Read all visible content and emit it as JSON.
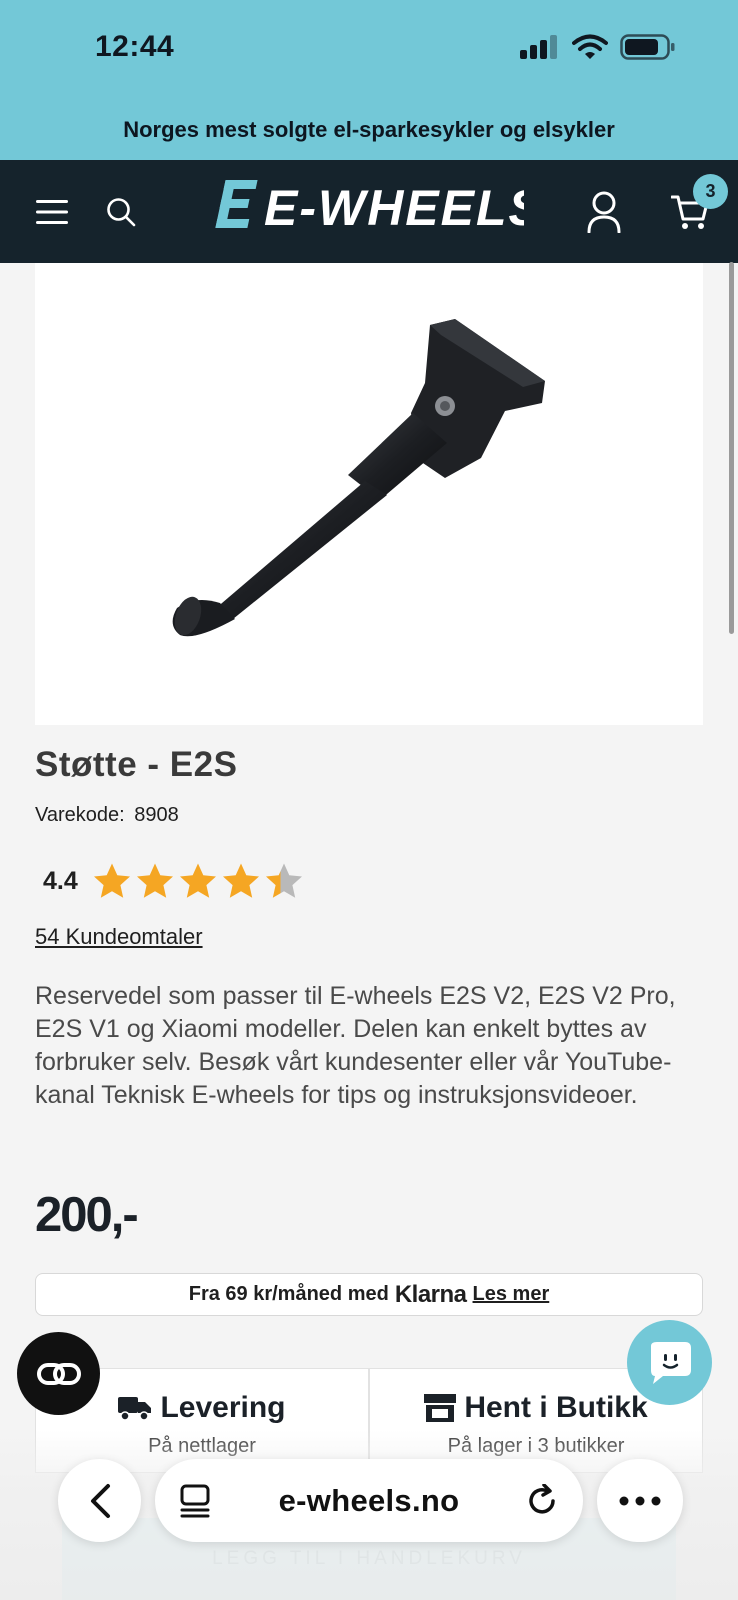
{
  "status_bar": {
    "time": "12:44"
  },
  "promo": {
    "text": "Norges mest solgte el-sparkesykler og elsykler"
  },
  "header": {
    "logo_text": "E-WHEELS",
    "cart_count": "3"
  },
  "product": {
    "title": "Støtte - E2S",
    "sku_label": "Varekode:",
    "sku_value": "8908",
    "rating_value": "4.4",
    "rating_fraction": 0.88,
    "reviews_link": "54 Kundeomtaler",
    "description": "Reservedel som passer til E-wheels E2S V2, E2S V2 Pro, E2S V1 og Xiaomi modeller. Delen kan enkelt byttes av forbruker selv. Besøk vårt kundesenter eller vår YouTube-kanal Teknisk E-wheels for tips og instruksjonsvideoer.",
    "price": "200,-"
  },
  "klarna": {
    "prefix": "Fra 69 kr/måned med",
    "brand": "Klarna",
    "link": "Les mer"
  },
  "delivery": {
    "shipping_title": "Levering",
    "shipping_sub": "På nettlager",
    "pickup_title": "Hent i Butikk",
    "pickup_sub": "På lager i 3 butikker"
  },
  "cta": {
    "label": "LEGG TIL I HANDLEKURV"
  },
  "browser": {
    "url": "e-wheels.no"
  },
  "colors": {
    "accent": "#73c8d7",
    "header_bg": "#15232c",
    "star": "#f5a623"
  }
}
